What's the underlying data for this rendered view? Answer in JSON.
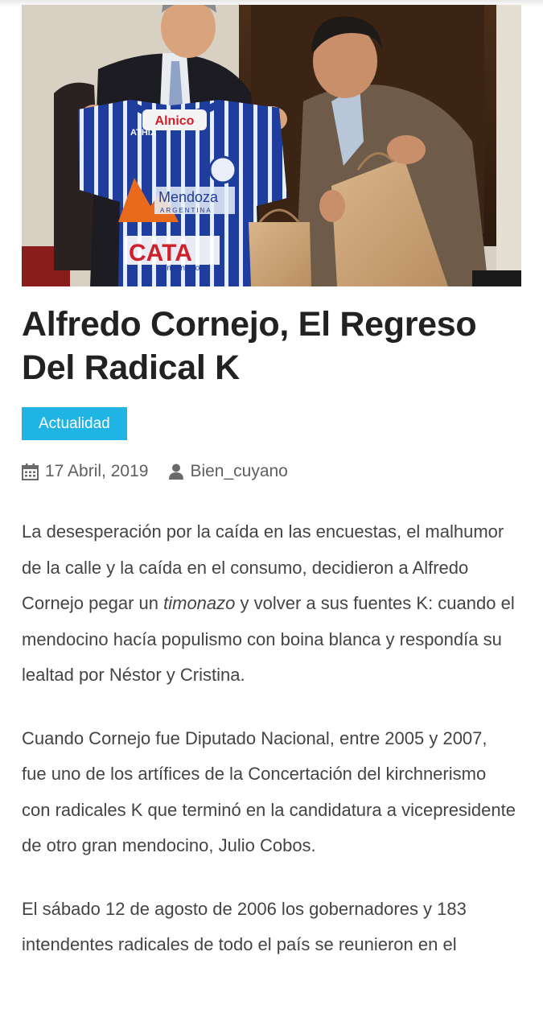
{
  "article": {
    "image_alt": "Dos hombres sosteniendo una camiseta de fútbol azul y blanca y bolsas de papel",
    "jersey_text": {
      "sponsor_top": "Alnico",
      "brand": "ATHIX",
      "mendoza": "Mendoza",
      "argentina": "ARGENTINA",
      "cata": "CATA",
      "internacional": "internacional"
    },
    "title": "Alfredo Cornejo, El Regreso Del Radical K",
    "category": "Actualidad",
    "date": "17 Abril, 2019",
    "author": "Bien_cuyano",
    "paragraph1": {
      "before": "La desesperación por la caída en las encuestas, el malhumor de la calle y la caída en el consumo, decidieron a Alfredo Cornejo pegar un ",
      "emphasis": "timonazo",
      "after": " y volver a sus fuentes K: cuando el mendocino hacía populismo con boina blanca y respondía su lealtad por Néstor y Cristina."
    },
    "paragraph2": "Cuando Cornejo fue Diputado Nacional, entre 2005 y 2007, fue uno de los artífices de la Concertación del kirchnerismo con radicales K que terminó en la candidatura a vicepresidente de otro gran mendocino, Julio Cobos.",
    "paragraph3": "El sábado 12 de agosto de 2006 los gobernadores y 183 intendentes radicales de todo el país se reunieron en el"
  },
  "icons": {
    "date": "calendar-icon",
    "author": "user-icon"
  },
  "colors": {
    "category_bg": "#1fb4e3",
    "title": "#222222",
    "text": "#444444"
  }
}
